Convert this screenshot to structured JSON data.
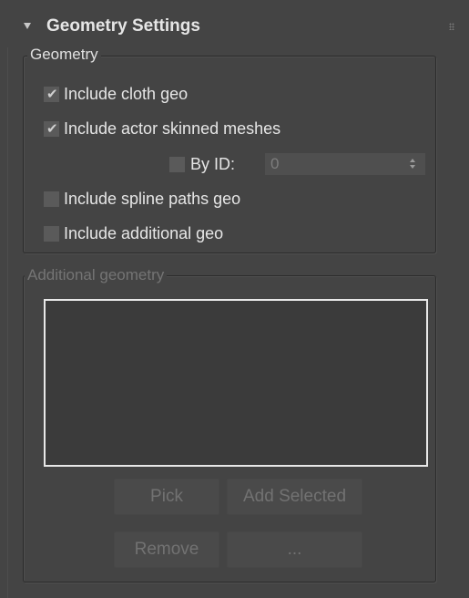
{
  "rollout": {
    "title": "Geometry Settings"
  },
  "geometry_group": {
    "legend": "Geometry",
    "include_cloth": {
      "label": "Include cloth geo",
      "checked": true
    },
    "include_skinned": {
      "label": "Include actor skinned meshes",
      "checked": true
    },
    "by_id": {
      "label": "By ID:",
      "checked": false,
      "value": "0"
    },
    "include_spline": {
      "label": "Include spline paths geo",
      "checked": false
    },
    "include_additional": {
      "label": "Include additional geo",
      "checked": false
    }
  },
  "additional_group": {
    "legend": "Additional geometry",
    "items": [],
    "buttons": {
      "pick": "Pick",
      "add_selected": "Add Selected",
      "remove": "Remove",
      "more": "..."
    }
  },
  "colors": {
    "panel_bg": "#444444",
    "text": "#e6e6e6",
    "disabled_text": "#727272",
    "list_bg": "#3b3b3b",
    "list_border": "#e8e8e8"
  }
}
